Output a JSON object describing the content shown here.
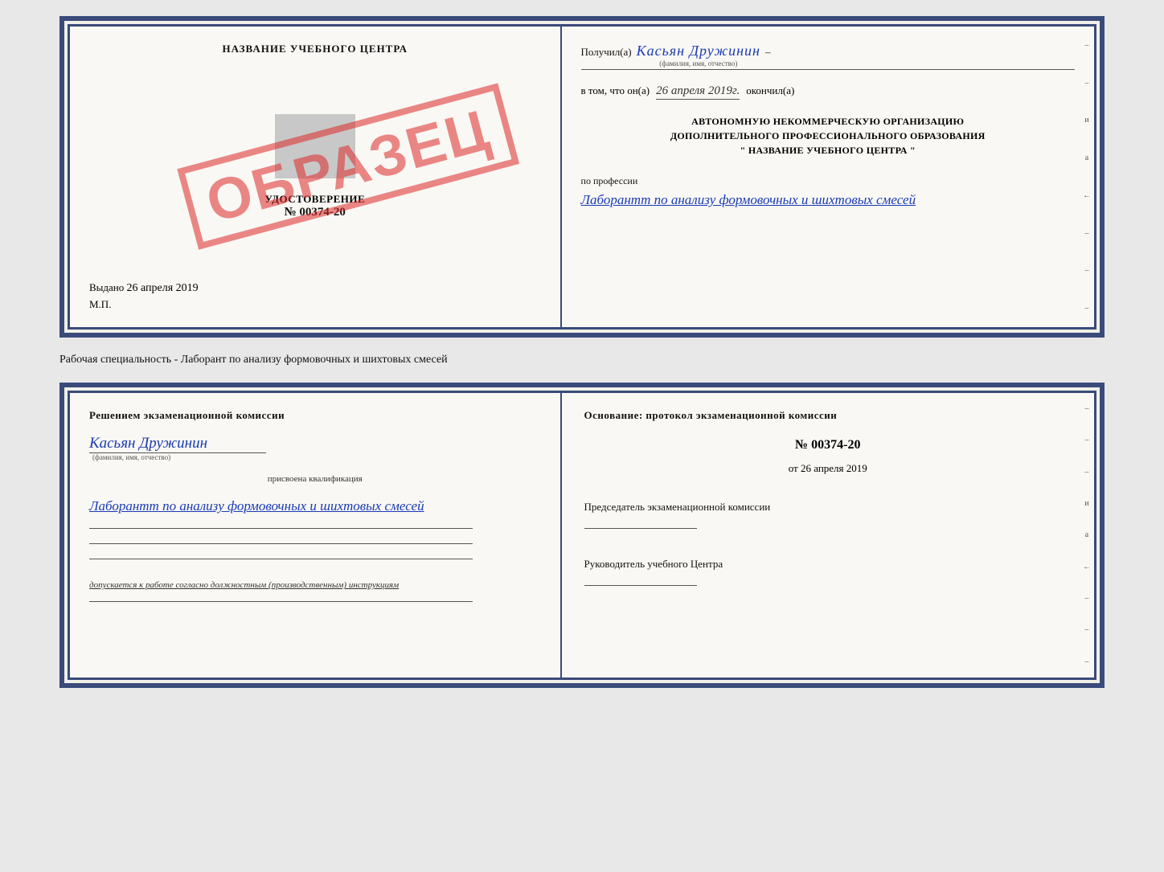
{
  "topCert": {
    "left": {
      "title": "НАЗВАНИЕ УЧЕБНОГО ЦЕНТРА",
      "stampText": "ОБРАЗЕЦ",
      "udostoverenie": "УДОСТОВЕРЕНИЕ",
      "number": "№ 00374-20",
      "vydano": "Выдано",
      "vydanoDate": "26 апреля 2019",
      "mp": "М.П."
    },
    "right": {
      "poluchil": "Получил(а)",
      "name": "Касьян Дружинин",
      "fioLabel": "(фамилия, имя, отчество)",
      "vtomLabel": "в том, что он(а)",
      "date": "26 апреля 2019г.",
      "okonchil": "окончил(а)",
      "orgLine1": "АВТОНОМНУЮ НЕКОММЕРЧЕСКУЮ ОРГАНИЗАЦИЮ",
      "orgLine2": "ДОПОЛНИТЕЛЬНОГО ПРОФЕССИОНАЛЬНОГО ОБРАЗОВАНИЯ",
      "orgLine3": "\"    НАЗВАНИЕ УЧЕБНОГО ЦЕНТРА    \"",
      "poProfessii": "по профессии",
      "profession": "Лаборантт по анализу формовочных и шихтовых смесей",
      "sideMarks": [
        "–",
        "–",
        "и",
        "а",
        "←",
        "–",
        "–",
        "–"
      ]
    }
  },
  "middleText": "Рабочая специальность - Лаборант по анализу формовочных и шихтовых смесей",
  "bottomCert": {
    "left": {
      "resheniem": "Решением  экзаменационной  комиссии",
      "name": "Касьян Дружинин",
      "fioLabel": "(фамилия, имя, отчество)",
      "prisvoena": "присвоена квалификация",
      "profession": "Лаборантт по анализу формовочных и шихтовых смесей",
      "dopuskaetsya": "допускается к  работе согласно должностным (производственным) инструкциям"
    },
    "right": {
      "osnovanie": "Основание: протокол экзаменационной  комиссии",
      "number": "№  00374-20",
      "ot": "от",
      "date": "26 апреля 2019",
      "predsedatel": "Председатель экзаменационной комиссии",
      "rukovoditel": "Руководитель учебного Центра",
      "sideMarks": [
        "–",
        "–",
        "–",
        "и",
        "а",
        "←",
        "–",
        "–",
        "–"
      ]
    }
  }
}
